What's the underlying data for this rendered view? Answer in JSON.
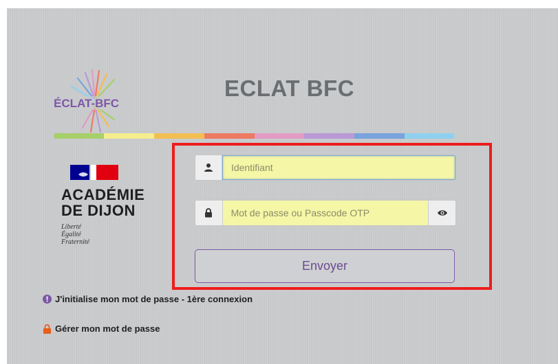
{
  "header": {
    "app_logo_text": "ÉCLAT-BFC",
    "title": "ECLAT BFC"
  },
  "color_bar": [
    "#a7cf6a",
    "#f4ee8e",
    "#f3be53",
    "#ef7a63",
    "#e39bc4",
    "#b99ad6",
    "#7aa3dd",
    "#8fd0ee"
  ],
  "academie": {
    "name_line1": "ACADÉMIE",
    "name_line2": "DE DIJON",
    "motto": [
      "Liberté",
      "Égalité",
      "Fraternité"
    ]
  },
  "form": {
    "username": {
      "value": "",
      "placeholder": "Identifiant",
      "icon": "user-icon"
    },
    "password": {
      "value": "",
      "placeholder": "Mot de passe ou Passcode OTP",
      "icon": "lock-icon",
      "toggle_icon": "eye-icon"
    },
    "submit_label": "Envoyer"
  },
  "links": {
    "init_password": "J'initialise mon mot de passe - 1ère connexion",
    "manage_password": "Gérer mon mot de passe"
  },
  "colors": {
    "background": "#c9cbcd",
    "title": "#6b6e70",
    "accent_purple": "#7d57a6",
    "input_fill": "#f5f6a6",
    "highlight_red": "#ee1c1c",
    "info_icon": "#7d57a6",
    "lock_link_icon": "#e65f1b"
  }
}
